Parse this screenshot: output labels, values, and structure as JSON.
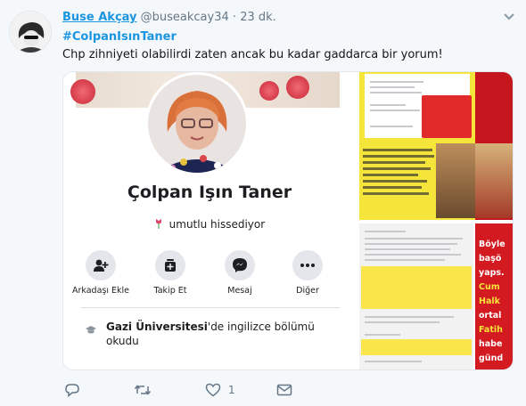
{
  "tweet": {
    "display_name": "Buse Akçay",
    "handle": "@buseakcay34",
    "separator": "·",
    "time": "23 dk.",
    "hashtag": "#ColpanIsınTaner",
    "text": "Chp zihniyeti olabilirdi zaten ancak bu kadar gaddarca bir yorum!"
  },
  "media": {
    "profile": {
      "name": "Çolpan Işın Taner",
      "feeling": "umutlu hissediyor",
      "actions": [
        {
          "label": "Arkadaşı Ekle",
          "icon": "add-friend-icon"
        },
        {
          "label": "Takip Et",
          "icon": "follow-icon"
        },
        {
          "label": "Mesaj",
          "icon": "messenger-icon"
        },
        {
          "label": "Diğer",
          "icon": "more-icon"
        }
      ],
      "education_school": "Gazi Üniversitesi",
      "education_rest": "'de ingilizce bölümü okudu"
    },
    "right_panel": {
      "red_text_lines": [
        "Böyle",
        "başö",
        "yaps.",
        "Cum",
        "Halk",
        "ortal",
        "Fatih",
        "habe",
        "günd"
      ],
      "red_text_colors": [
        "#ffffff",
        "#ffffff",
        "#ffffff",
        "#f5e43a",
        "#f5e43a",
        "#ffffff",
        "#f5e43a",
        "#ffffff",
        "#ffffff"
      ]
    }
  },
  "actions": {
    "reply_icon": "reply-icon",
    "retweet_icon": "retweet-icon",
    "like_icon": "heart-icon",
    "like_count": "1",
    "message_icon": "envelope-icon"
  },
  "colors": {
    "link": "#1b95e0",
    "muted": "#657786",
    "background": "#f5f8fa"
  }
}
